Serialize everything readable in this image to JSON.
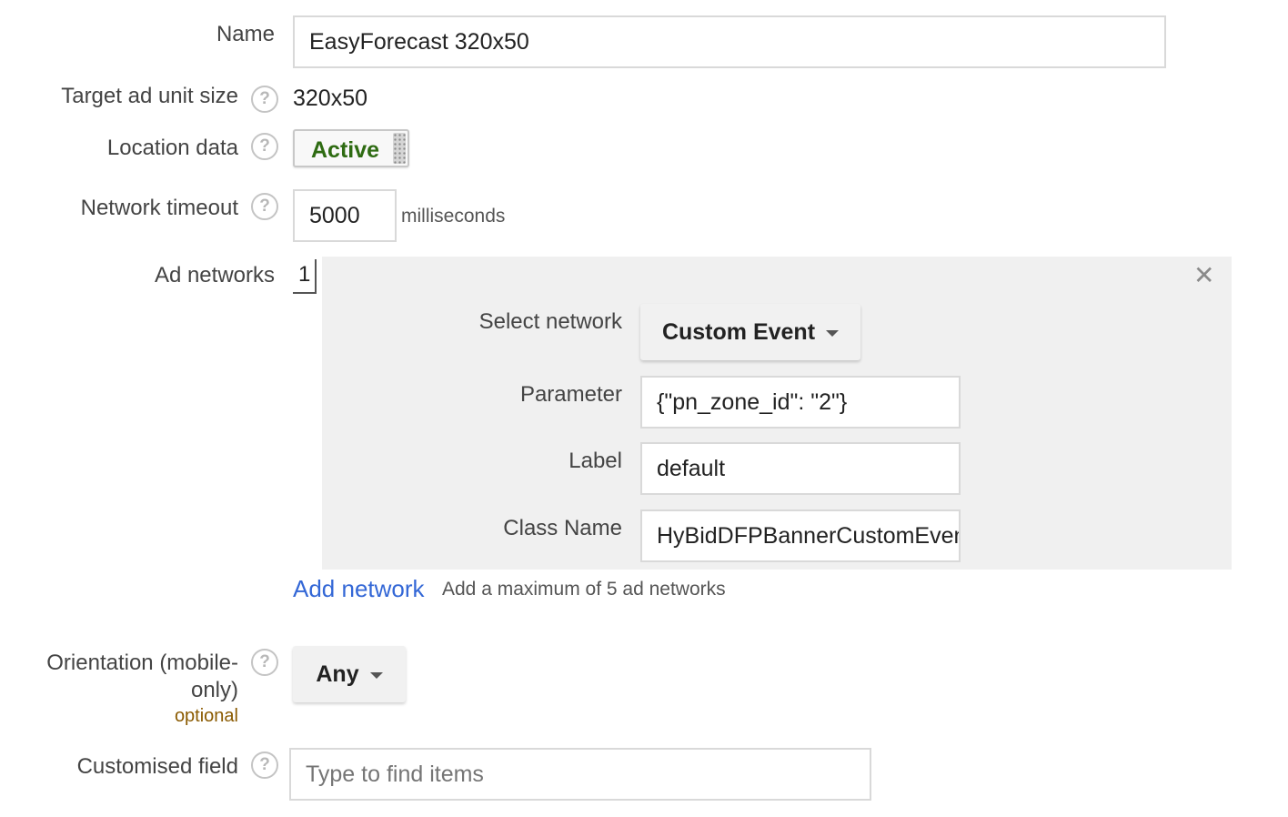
{
  "form": {
    "name": {
      "label": "Name",
      "value": "EasyForecast 320x50"
    },
    "target_size": {
      "label": "Target ad unit size",
      "value": "320x50"
    },
    "location_data": {
      "label": "Location data",
      "toggle_label": "Active"
    },
    "network_timeout": {
      "label": "Network timeout",
      "value": "5000",
      "unit": "milliseconds"
    },
    "ad_networks": {
      "label": "Ad networks",
      "index": "1",
      "close_glyph": "✕",
      "select_network": {
        "label": "Select network",
        "value": "Custom Event"
      },
      "parameter": {
        "label": "Parameter",
        "value": "{\"pn_zone_id\": \"2\"}"
      },
      "label_field": {
        "label": "Label",
        "value": "default"
      },
      "class_name": {
        "label": "Class Name",
        "value": "HyBidDFPBannerCustomEvent"
      },
      "add_link": "Add network",
      "add_hint": "Add a maximum of 5 ad networks"
    },
    "orientation": {
      "label_line1": "Orientation (mobile-",
      "label_line2": "only)",
      "optional": "optional",
      "value": "Any"
    },
    "customised_field": {
      "label": "Customised field",
      "placeholder": "Type to find items"
    }
  },
  "help_glyph": "?",
  "colors": {
    "active_green": "#2e6b12",
    "link_blue": "#3367d6",
    "optional_brown": "#8a5a00",
    "panel_bg": "#f0f0f0"
  },
  "icons": [
    "help-icon",
    "close-icon",
    "caret-down-icon",
    "drag-handle-icon"
  ]
}
